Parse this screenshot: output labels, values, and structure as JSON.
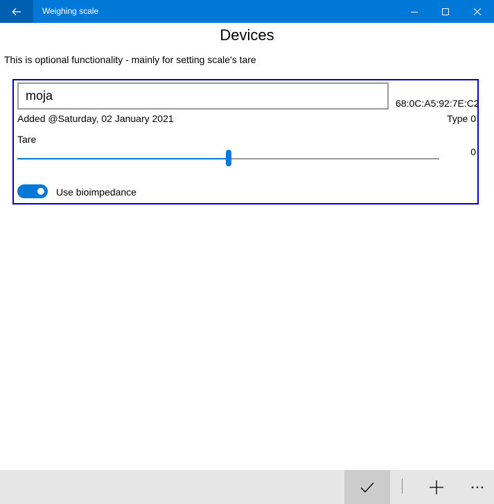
{
  "window": {
    "title": "Weighing scale"
  },
  "page": {
    "title": "Devices",
    "subtitle": "This is optional functionality - mainly for setting scale's tare"
  },
  "device": {
    "name": "moja",
    "mac": "68:0C:A5:92:7E:C2",
    "added": "Added @Saturday, 02 January 2021",
    "type": "Type 0",
    "tare_label": "Tare",
    "tare_value": "0",
    "tare_slider_fraction": 0.5,
    "bioimpedance_label": "Use bioimpedance",
    "bioimpedance_on": true
  },
  "icons": {
    "back": "back-arrow-icon",
    "minimize": "minimize-icon",
    "maximize": "maximize-icon",
    "close": "close-icon",
    "accept": "checkmark-icon",
    "add": "plus-icon",
    "more": "more-icon"
  },
  "colors": {
    "accent": "#0078d7",
    "card_border": "#0000cc",
    "command_bar": "#e6e6e6"
  }
}
